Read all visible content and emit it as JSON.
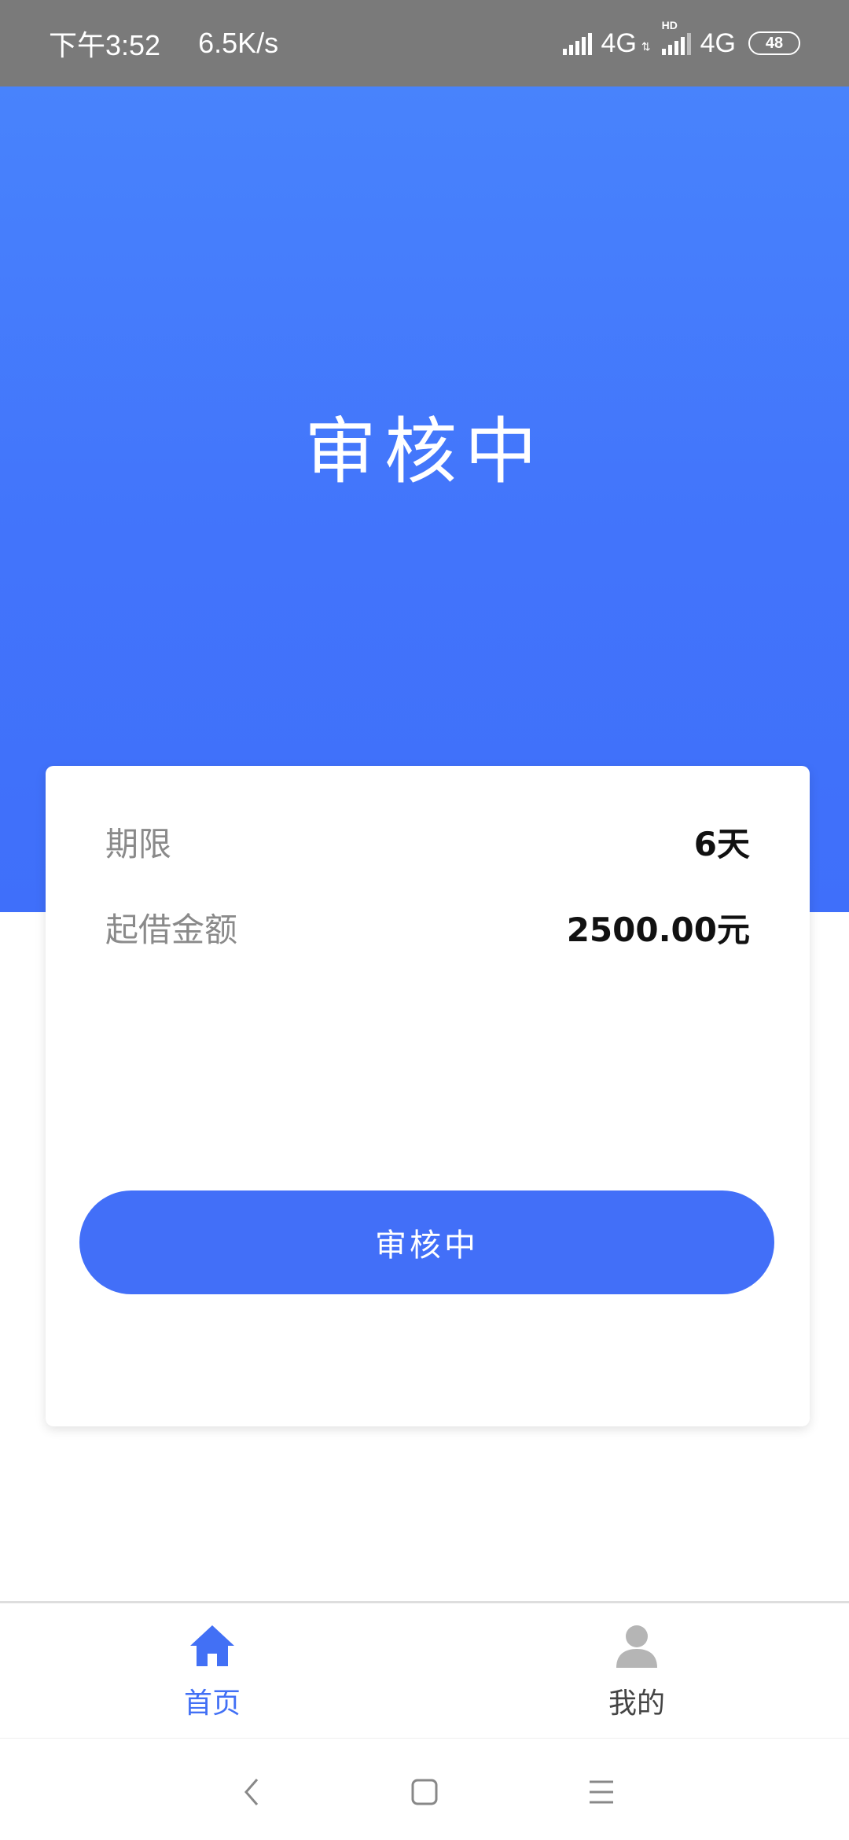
{
  "status_bar": {
    "time": "下午3:52",
    "speed": "6.5K/s",
    "network1": "4G",
    "hd_label": "HD",
    "network2": "4G",
    "battery": "48"
  },
  "hero": {
    "title": "审核中"
  },
  "card": {
    "rows": [
      {
        "label": "期限",
        "value": "6天"
      },
      {
        "label": "起借金额",
        "value": "2500.00元"
      }
    ],
    "button_label": "审核中"
  },
  "tabbar": {
    "items": [
      {
        "label": "首页",
        "icon": "home-icon",
        "active": true
      },
      {
        "label": "我的",
        "icon": "person-icon",
        "active": false
      }
    ]
  },
  "nav_bar": {
    "buttons": [
      "back-icon",
      "home-square-icon",
      "menu-icon"
    ]
  },
  "colors": {
    "accent": "#426ff8",
    "status_bar_bg": "#7a7a7a",
    "hero_top": "#4883fc",
    "hero_bottom": "#3f6ffa",
    "label_gray": "#8a8a8a"
  }
}
